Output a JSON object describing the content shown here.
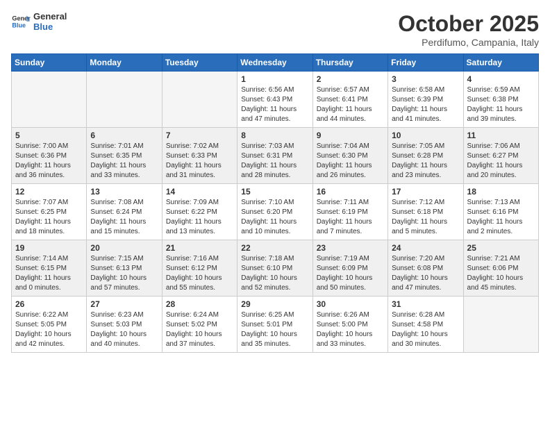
{
  "header": {
    "logo_line1": "General",
    "logo_line2": "Blue",
    "month": "October 2025",
    "location": "Perdifumo, Campania, Italy"
  },
  "days_of_week": [
    "Sunday",
    "Monday",
    "Tuesday",
    "Wednesday",
    "Thursday",
    "Friday",
    "Saturday"
  ],
  "weeks": [
    [
      {
        "day": "",
        "info": ""
      },
      {
        "day": "",
        "info": ""
      },
      {
        "day": "",
        "info": ""
      },
      {
        "day": "1",
        "info": "Sunrise: 6:56 AM\nSunset: 6:43 PM\nDaylight: 11 hours and 47 minutes."
      },
      {
        "day": "2",
        "info": "Sunrise: 6:57 AM\nSunset: 6:41 PM\nDaylight: 11 hours and 44 minutes."
      },
      {
        "day": "3",
        "info": "Sunrise: 6:58 AM\nSunset: 6:39 PM\nDaylight: 11 hours and 41 minutes."
      },
      {
        "day": "4",
        "info": "Sunrise: 6:59 AM\nSunset: 6:38 PM\nDaylight: 11 hours and 39 minutes."
      }
    ],
    [
      {
        "day": "5",
        "info": "Sunrise: 7:00 AM\nSunset: 6:36 PM\nDaylight: 11 hours and 36 minutes."
      },
      {
        "day": "6",
        "info": "Sunrise: 7:01 AM\nSunset: 6:35 PM\nDaylight: 11 hours and 33 minutes."
      },
      {
        "day": "7",
        "info": "Sunrise: 7:02 AM\nSunset: 6:33 PM\nDaylight: 11 hours and 31 minutes."
      },
      {
        "day": "8",
        "info": "Sunrise: 7:03 AM\nSunset: 6:31 PM\nDaylight: 11 hours and 28 minutes."
      },
      {
        "day": "9",
        "info": "Sunrise: 7:04 AM\nSunset: 6:30 PM\nDaylight: 11 hours and 26 minutes."
      },
      {
        "day": "10",
        "info": "Sunrise: 7:05 AM\nSunset: 6:28 PM\nDaylight: 11 hours and 23 minutes."
      },
      {
        "day": "11",
        "info": "Sunrise: 7:06 AM\nSunset: 6:27 PM\nDaylight: 11 hours and 20 minutes."
      }
    ],
    [
      {
        "day": "12",
        "info": "Sunrise: 7:07 AM\nSunset: 6:25 PM\nDaylight: 11 hours and 18 minutes."
      },
      {
        "day": "13",
        "info": "Sunrise: 7:08 AM\nSunset: 6:24 PM\nDaylight: 11 hours and 15 minutes."
      },
      {
        "day": "14",
        "info": "Sunrise: 7:09 AM\nSunset: 6:22 PM\nDaylight: 11 hours and 13 minutes."
      },
      {
        "day": "15",
        "info": "Sunrise: 7:10 AM\nSunset: 6:20 PM\nDaylight: 11 hours and 10 minutes."
      },
      {
        "day": "16",
        "info": "Sunrise: 7:11 AM\nSunset: 6:19 PM\nDaylight: 11 hours and 7 minutes."
      },
      {
        "day": "17",
        "info": "Sunrise: 7:12 AM\nSunset: 6:18 PM\nDaylight: 11 hours and 5 minutes."
      },
      {
        "day": "18",
        "info": "Sunrise: 7:13 AM\nSunset: 6:16 PM\nDaylight: 11 hours and 2 minutes."
      }
    ],
    [
      {
        "day": "19",
        "info": "Sunrise: 7:14 AM\nSunset: 6:15 PM\nDaylight: 11 hours and 0 minutes."
      },
      {
        "day": "20",
        "info": "Sunrise: 7:15 AM\nSunset: 6:13 PM\nDaylight: 10 hours and 57 minutes."
      },
      {
        "day": "21",
        "info": "Sunrise: 7:16 AM\nSunset: 6:12 PM\nDaylight: 10 hours and 55 minutes."
      },
      {
        "day": "22",
        "info": "Sunrise: 7:18 AM\nSunset: 6:10 PM\nDaylight: 10 hours and 52 minutes."
      },
      {
        "day": "23",
        "info": "Sunrise: 7:19 AM\nSunset: 6:09 PM\nDaylight: 10 hours and 50 minutes."
      },
      {
        "day": "24",
        "info": "Sunrise: 7:20 AM\nSunset: 6:08 PM\nDaylight: 10 hours and 47 minutes."
      },
      {
        "day": "25",
        "info": "Sunrise: 7:21 AM\nSunset: 6:06 PM\nDaylight: 10 hours and 45 minutes."
      }
    ],
    [
      {
        "day": "26",
        "info": "Sunrise: 6:22 AM\nSunset: 5:05 PM\nDaylight: 10 hours and 42 minutes."
      },
      {
        "day": "27",
        "info": "Sunrise: 6:23 AM\nSunset: 5:03 PM\nDaylight: 10 hours and 40 minutes."
      },
      {
        "day": "28",
        "info": "Sunrise: 6:24 AM\nSunset: 5:02 PM\nDaylight: 10 hours and 37 minutes."
      },
      {
        "day": "29",
        "info": "Sunrise: 6:25 AM\nSunset: 5:01 PM\nDaylight: 10 hours and 35 minutes."
      },
      {
        "day": "30",
        "info": "Sunrise: 6:26 AM\nSunset: 5:00 PM\nDaylight: 10 hours and 33 minutes."
      },
      {
        "day": "31",
        "info": "Sunrise: 6:28 AM\nSunset: 4:58 PM\nDaylight: 10 hours and 30 minutes."
      },
      {
        "day": "",
        "info": ""
      }
    ]
  ]
}
